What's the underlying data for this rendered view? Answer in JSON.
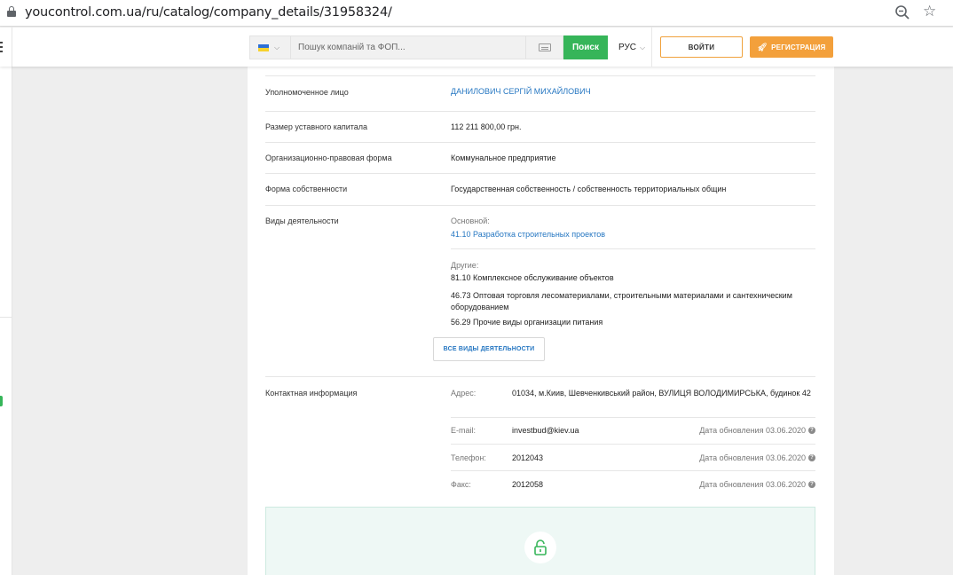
{
  "browser": {
    "url": "youcontrol.com.ua/ru/catalog/company_details/31958324/"
  },
  "header": {
    "search_placeholder": "Пошук компаній та ФОП...",
    "search_button": "Поиск",
    "language": "РУС",
    "login_button": "ВОЙТИ",
    "register_button": "РЕГИСТРАЦИЯ"
  },
  "details": {
    "authorized_person": {
      "label": "Уполномоченное лицо",
      "value": "ДАНИЛОВИЧ СЕРГІЙ МИХАЙЛОВИЧ"
    },
    "capital": {
      "label": "Размер уставного капитала",
      "value": "112 211 800,00 грн."
    },
    "legal_form": {
      "label": "Организационно-правовая форма",
      "value": "Коммунальное предприятие"
    },
    "ownership": {
      "label": "Форма собственности",
      "value": "Государственная собственность / собственность территориальных общин"
    },
    "activities": {
      "label": "Виды деятельности",
      "main_label": "Основной:",
      "main_value": "41.10 Разработка строительных проектов",
      "other_label": "Другие:",
      "others": [
        "81.10 Комплексное обслуживание объектов",
        "46.73 Оптовая торговля лесоматериалами, строительными материалами и сантехническим оборудованием",
        "56.29 Прочие виды организации питания"
      ],
      "all_button": "ВСЕ ВИДЫ ДЕЯТЕЛЬНОСТИ"
    },
    "contacts": {
      "label": "Контактная информация",
      "address_label": "Адрес:",
      "address_value": "01034, м.Киив, Шевченкивський район, ВУЛИЦЯ ВОЛОДИМИРСЬКА, будинок 42",
      "email_label": "E-mail:",
      "email_value": "investbud@kiev.ua",
      "phone_label": "Телефон:",
      "phone_value": "2012043",
      "fax_label": "Факс:",
      "fax_value": "2012058",
      "update_date": "Дата обновления 03.06.2020"
    }
  },
  "colors": {
    "accent_green": "#36b559",
    "accent_orange": "#f3a03b",
    "link_blue": "#2677c2"
  }
}
